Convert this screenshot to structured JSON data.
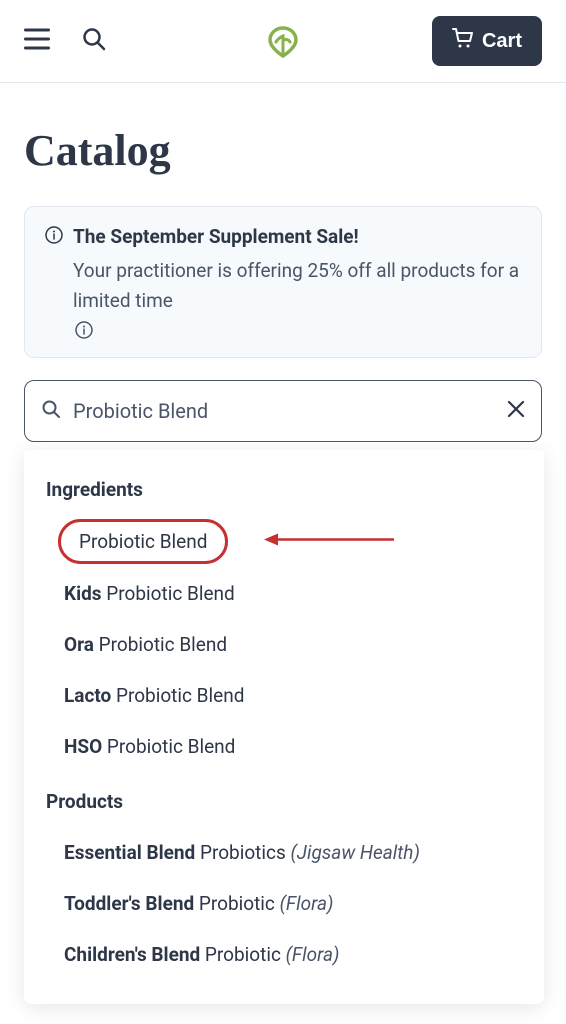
{
  "header": {
    "cart_label": "Cart"
  },
  "page": {
    "title": "Catalog"
  },
  "banner": {
    "title": "The September Supplement Sale!",
    "body": "Your practitioner is offering 25% off all products for a limited time"
  },
  "search": {
    "value": "Probiotic Blend"
  },
  "dropdown": {
    "sections": [
      {
        "title": "Ingredients",
        "items": [
          {
            "bold": "",
            "rest": "Probiotic Blend",
            "brand": "",
            "highlighted": true
          },
          {
            "bold": "Kids",
            "rest": " Probiotic Blend",
            "brand": ""
          },
          {
            "bold": "Ora",
            "rest": " Probiotic Blend",
            "brand": ""
          },
          {
            "bold": "Lacto",
            "rest": " Probiotic Blend",
            "brand": ""
          },
          {
            "bold": "HSO",
            "rest": " Probiotic Blend",
            "brand": ""
          }
        ]
      },
      {
        "title": "Products",
        "items": [
          {
            "bold": "Essential Blend",
            "rest": " Probiotics ",
            "brand": "(Jigsaw Health)"
          },
          {
            "bold": "Toddler's Blend",
            "rest": " Probiotic ",
            "brand": "(Flora)"
          },
          {
            "bold": "Children's Blend",
            "rest": " Probiotic ",
            "brand": "(Flora)"
          }
        ]
      }
    ]
  }
}
